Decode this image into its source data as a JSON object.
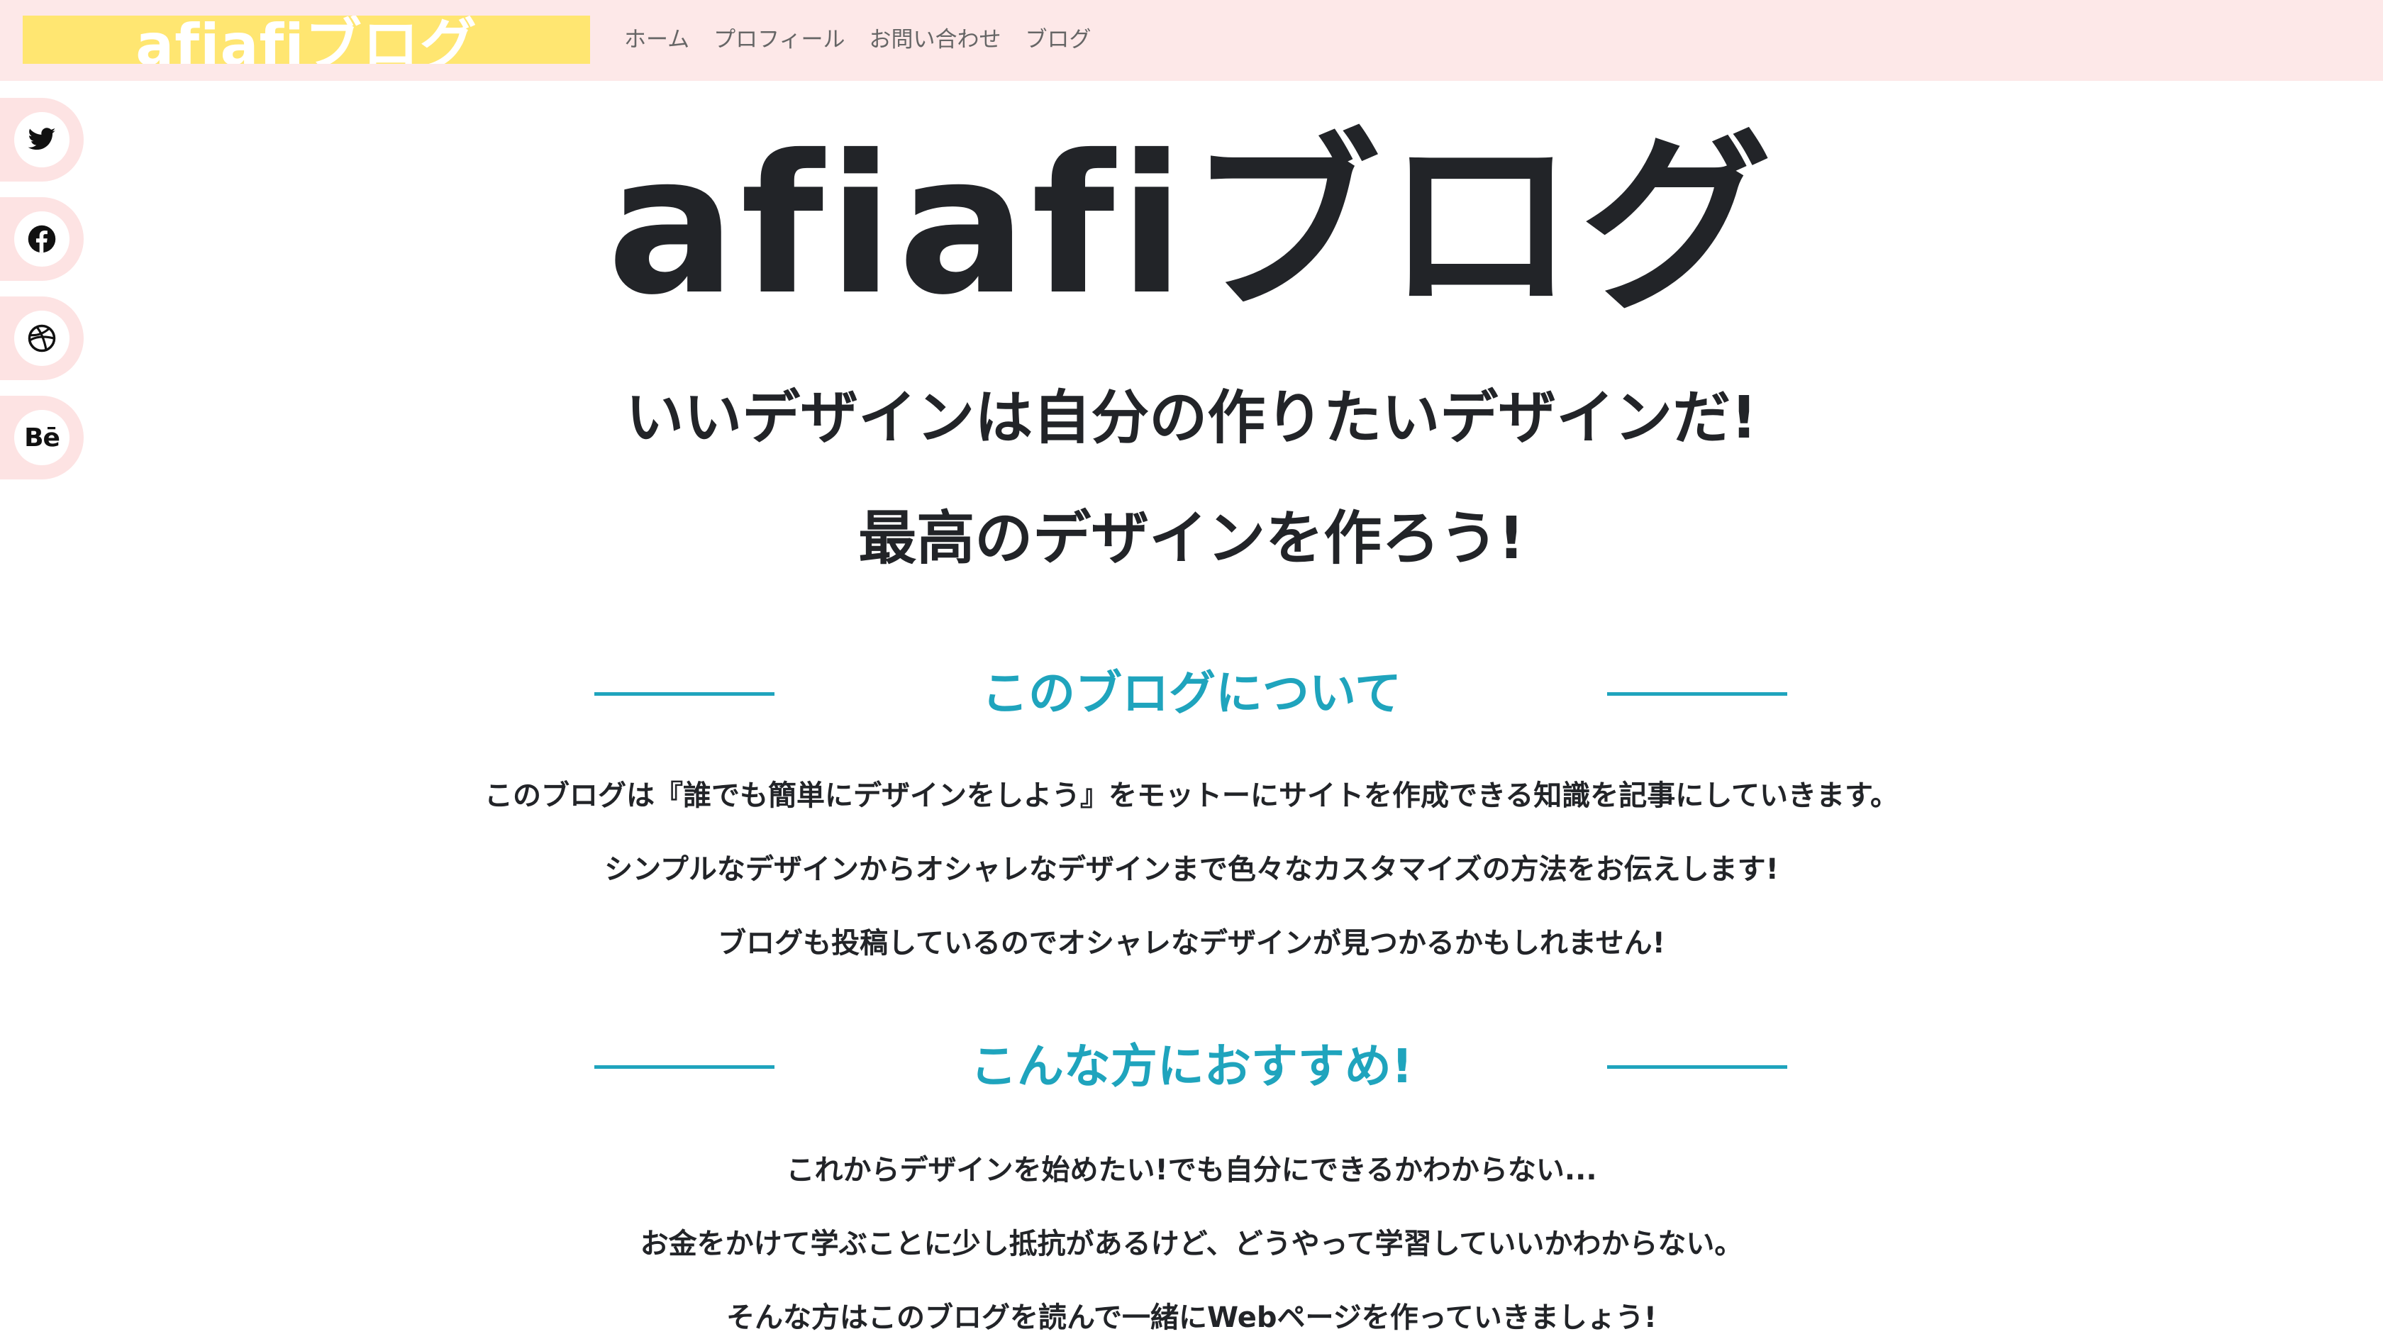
{
  "header": {
    "logo": "afiafiブログ",
    "nav": [
      "ホーム",
      "プロフィール",
      "お問い合わせ",
      "ブログ"
    ]
  },
  "social": [
    {
      "icon": "twitter-icon"
    },
    {
      "icon": "facebook-icon"
    },
    {
      "icon": "dribbble-icon"
    },
    {
      "icon": "behance-icon",
      "glyph": "Bē"
    }
  ],
  "hero": {
    "title": "afiafiブログ",
    "subtitle_1": "いいデザインは自分の作りたいデザインだ!",
    "subtitle_2": "最高のデザインを作ろう!"
  },
  "about": {
    "heading": "このブログについて",
    "lines": [
      "このブログは『誰でも簡単にデザインをしよう』をモットーにサイトを作成できる知識を記事にしていきます。",
      "シンプルなデザインからオシャレなデザインまで色々なカスタマイズの方法をお伝えします!",
      "ブログも投稿しているのでオシャレなデザインが見つかるかもしれません!"
    ]
  },
  "recommend": {
    "heading": "こんな方におすすめ!",
    "lines": [
      "これからデザインを始めたい!でも自分にできるかわからない...",
      "お金をかけて学ぶことに少し抵抗があるけど、どうやって学習していいかわからない。",
      "そんな方はこのブログを読んで一緒にWebページを作っていきましょう!"
    ]
  },
  "colors": {
    "topbar_bg": "#fde8e8",
    "logo_bg": "#ffe671",
    "accent": "#1fa4bd",
    "text": "#222428"
  }
}
